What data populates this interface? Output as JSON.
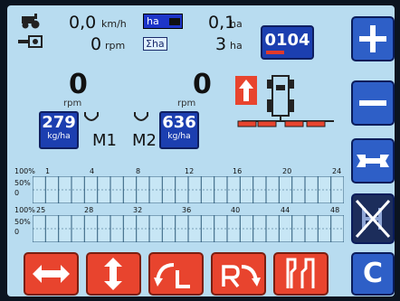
{
  "status": {
    "speed_value": "0,0",
    "speed_unit": "km/h",
    "rpm_value": "0",
    "rpm_unit": "rpm",
    "area_value": "0,1",
    "area_unit": "ha",
    "total_area_value": "3",
    "total_area_unit": "ha",
    "area_badge": "ha",
    "total_area_badge": "Σha",
    "counter": "0104"
  },
  "meters": {
    "left_rpm_value": "0",
    "left_rpm_label": "rpm",
    "right_rpm_value": "0",
    "right_rpm_label": "rpm",
    "m1_rate_value": "279",
    "m1_rate_unit": "kg/ha",
    "m2_rate_value": "636",
    "m2_rate_unit": "kg/ha",
    "m1_label": "M1",
    "m2_label": "M2"
  },
  "section_grid": {
    "row1_scale": [
      "100%",
      "50%",
      "0"
    ],
    "row1_ticks": [
      "1",
      "4",
      "8",
      "12",
      "16",
      "20",
      "24"
    ],
    "row2_scale": [
      "100%",
      "50%",
      "0"
    ],
    "row2_ticks": [
      "25",
      "28",
      "32",
      "36",
      "40",
      "44",
      "48"
    ]
  },
  "side_buttons": [
    {
      "name": "plus",
      "symbol": "+"
    },
    {
      "name": "minus",
      "symbol": "−"
    },
    {
      "name": "tools",
      "symbol": "wrench"
    },
    {
      "name": "disabled-h",
      "symbol": "H"
    }
  ],
  "bottom_buttons": [
    {
      "name": "horizontal-arrows"
    },
    {
      "name": "vertical-arrows"
    },
    {
      "name": "turn-left-L"
    },
    {
      "name": "turn-right-R"
    },
    {
      "name": "stairs"
    }
  ],
  "clear_button_label": "C",
  "colors": {
    "screen_bg": "#b8dcf0",
    "blue_button": "#2e5fc7",
    "red_button": "#e8442e",
    "dark_blue": "#1c3fb0"
  }
}
